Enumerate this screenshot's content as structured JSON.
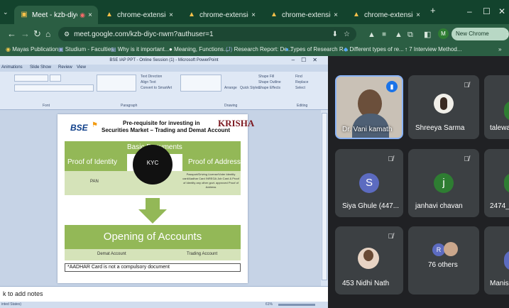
{
  "browser": {
    "tabs": [
      {
        "title": "Meet - kzb-diyc-nwm",
        "active": true,
        "recording_indicator": "◉",
        "close": "×"
      },
      {
        "title": "chrome-extension://appcm",
        "close": "×"
      },
      {
        "title": "chrome-extension://appcm",
        "close": "×"
      },
      {
        "title": "chrome-extension://appcm",
        "close": "×"
      },
      {
        "title": "chrome-extension://appcm",
        "close": "×"
      }
    ],
    "new_tab": "+",
    "window_controls": {
      "minimize": "–",
      "maximize": "☐",
      "close": "✕"
    },
    "url": "meet.google.com/kzb-diyc-nwm?authuser=1",
    "new_chrome_label": "New Chrome available",
    "profile_initial": "M",
    "bookmarks": [
      "Mayas Publication",
      "Studium - Faculties",
      "Why is it important...",
      "Meaning, Functions...",
      "Research Report: De...",
      "Types of Research R...",
      "Different types of re...",
      "7 Interview Method..."
    ],
    "bookmarks_more": "»"
  },
  "ppt": {
    "title": "BSE IAP PPT - Online Session (1) - Microsoft PowerPoint",
    "menu": [
      "Animations",
      "Slide Show",
      "Review",
      "View"
    ],
    "ribbon_groups": [
      "Font",
      "Paragraph",
      "Drawing",
      "Editing"
    ],
    "ribbon_labels": [
      "Text Direction",
      "Align Text",
      "Convert to SmartArt",
      "Arrange",
      "Quick Styles",
      "Shape Fill",
      "Shape Outline",
      "Shape Effects",
      "Find",
      "Replace",
      "Select"
    ],
    "slide": {
      "logo_left": "BSE",
      "heading_line1": "Pre-requisite for investing in",
      "heading_line2": "Securities Market – Trading and Demat Account",
      "logo_right": "KRISHA",
      "basic_doc_label": "Basic Documents",
      "kyc_label": "KYC",
      "proof_identity": "Proof of Identity",
      "proof_address": "Proof of Address",
      "pan_label": "PAN",
      "address_detail": "Passport/Driving License/Voter Identity card/Aadhar Card /NREGA Job Card & Proof of Identity any other govt. approved Proof of Address",
      "opening_label": "Opening of Accounts",
      "demat_label": "Demat Account",
      "trading_label": "Trading Account",
      "footnote": "*AADHAR Card is not a compulsory document"
    },
    "notes_placeholder": "k to add notes",
    "status_left": "inted States)",
    "zoom": "61%"
  },
  "participants": [
    {
      "name": "Dr. Vani kamath",
      "speaking": true,
      "has_video": true
    },
    {
      "name": "Shreeya Sarma",
      "muted": true,
      "avatar": "photo"
    },
    {
      "name": "talewa",
      "muted": false
    },
    {
      "name": "Siya Ghule (447...",
      "muted": true,
      "initial": "S",
      "color": "#5c6bc0"
    },
    {
      "name": "janhavi chavan",
      "muted": true,
      "initial": "j",
      "color": "#2e7d32"
    },
    {
      "name": "2474_",
      "initial": "",
      "color": "#2e7d32"
    },
    {
      "name": "453 Nidhi Nath",
      "muted": true,
      "avatar": "photo"
    },
    {
      "name": "76 others",
      "initial": "R",
      "color": "#5c6bc0"
    },
    {
      "name": "Manis",
      "initial": "",
      "color": "#5c6bc0"
    }
  ]
}
